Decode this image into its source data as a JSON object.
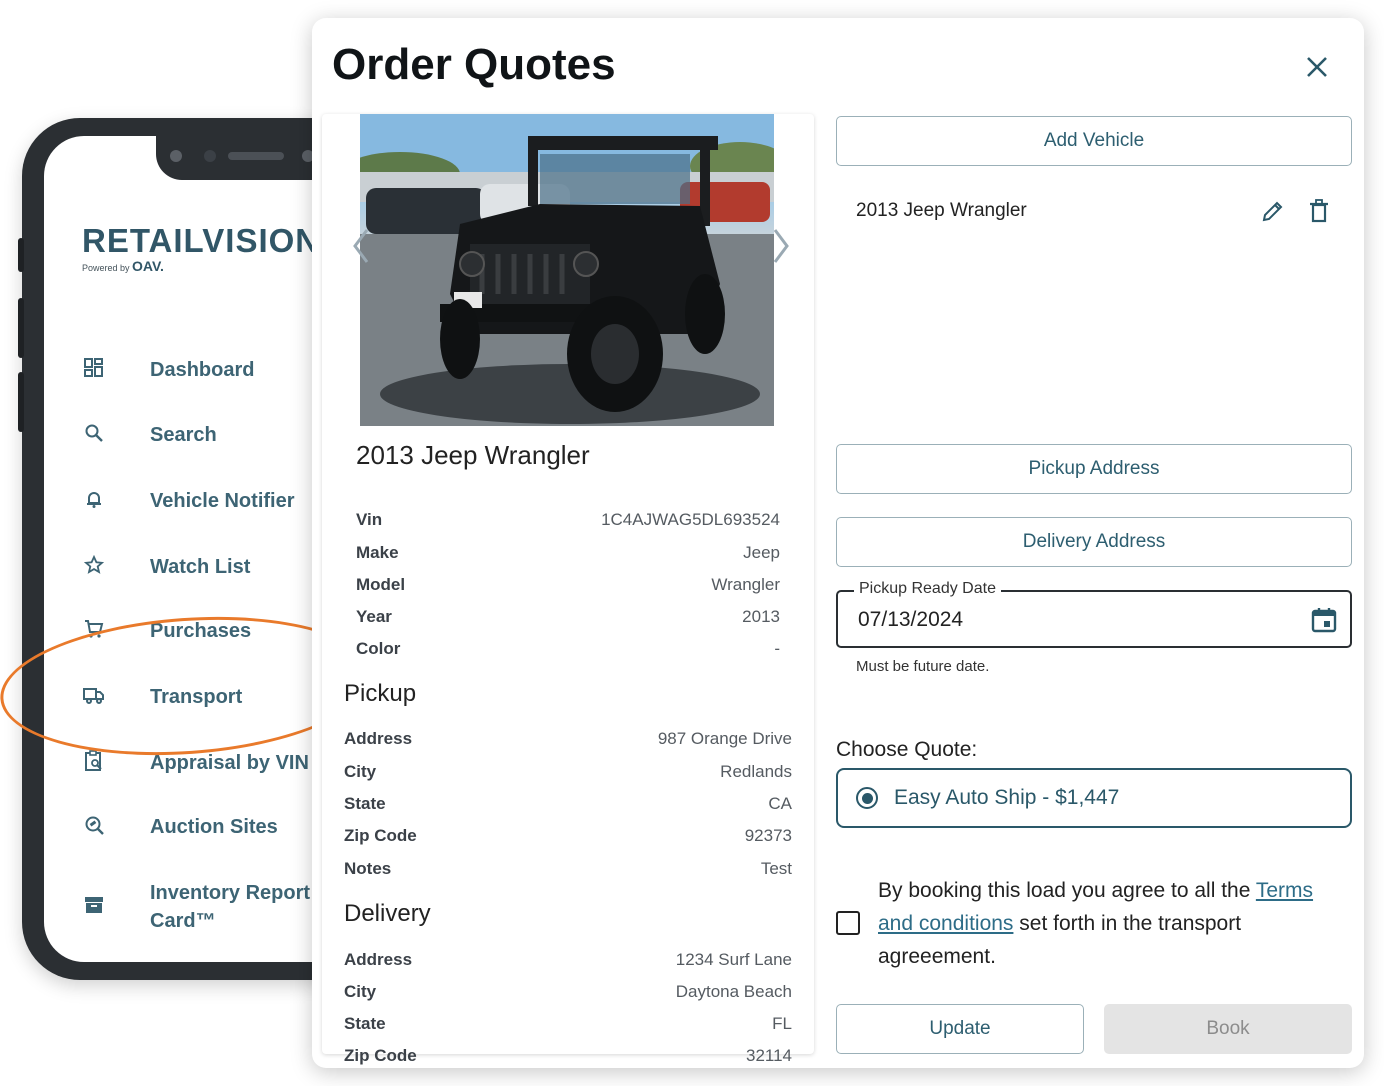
{
  "phone": {
    "brand": {
      "name": "RETAILVISION",
      "powered_by": "Powered by",
      "oav": "OAV."
    },
    "nav": [
      {
        "label": "Dashboard",
        "icon": "dashboard-icon"
      },
      {
        "label": "Search",
        "icon": "search-icon"
      },
      {
        "label": "Vehicle Notifier",
        "icon": "bell-icon"
      },
      {
        "label": "Watch List",
        "icon": "star-icon"
      },
      {
        "label": "Purchases",
        "icon": "cart-icon"
      },
      {
        "label": "Transport",
        "icon": "truck-icon"
      },
      {
        "label": "Appraisal by VIN",
        "icon": "clipboard-search-icon"
      },
      {
        "label": "Auction Sites",
        "icon": "gavel-search-icon"
      },
      {
        "label": "Inventory Report",
        "label2": "Card™",
        "icon": "archive-icon"
      }
    ],
    "highlight_color": "#e97a2b"
  },
  "modal": {
    "title": "Order Quotes",
    "vehicle": {
      "title": "2013 Jeep Wrangler",
      "fields": [
        {
          "k": "Vin",
          "v": "1C4AJWAG5DL693524"
        },
        {
          "k": "Make",
          "v": "Jeep"
        },
        {
          "k": "Model",
          "v": "Wrangler"
        },
        {
          "k": "Year",
          "v": "2013"
        },
        {
          "k": "Color",
          "v": "-"
        }
      ]
    },
    "pickup": {
      "title": "Pickup",
      "fields": [
        {
          "k": "Address",
          "v": "987 Orange Drive"
        },
        {
          "k": "City",
          "v": "Redlands"
        },
        {
          "k": "State",
          "v": "CA"
        },
        {
          "k": "Zip Code",
          "v": "92373"
        },
        {
          "k": "Notes",
          "v": "Test"
        }
      ]
    },
    "delivery": {
      "title": "Delivery",
      "fields": [
        {
          "k": "Address",
          "v": "1234 Surf Lane"
        },
        {
          "k": "City",
          "v": "Daytona Beach"
        },
        {
          "k": "State",
          "v": "FL"
        },
        {
          "k": "Zip Code",
          "v": "32114"
        }
      ]
    },
    "right": {
      "add_vehicle": "Add Vehicle",
      "vehicle_item": "2013 Jeep Wrangler",
      "pickup_address": "Pickup Address",
      "delivery_address": "Delivery Address",
      "pickup_date_label": "Pickup Ready Date",
      "pickup_date_value": "07/13/2024",
      "date_helper": "Must be future date.",
      "choose_quote": "Choose Quote:",
      "quote_option": "Easy Auto Ship - $1,447",
      "agree_before": "By booking this load you agree to all the ",
      "agree_link": "Terms and conditions",
      "agree_after": " set forth in the transport agreeement.",
      "update": "Update",
      "book": "Book"
    },
    "accent_color": "#2a5869"
  }
}
